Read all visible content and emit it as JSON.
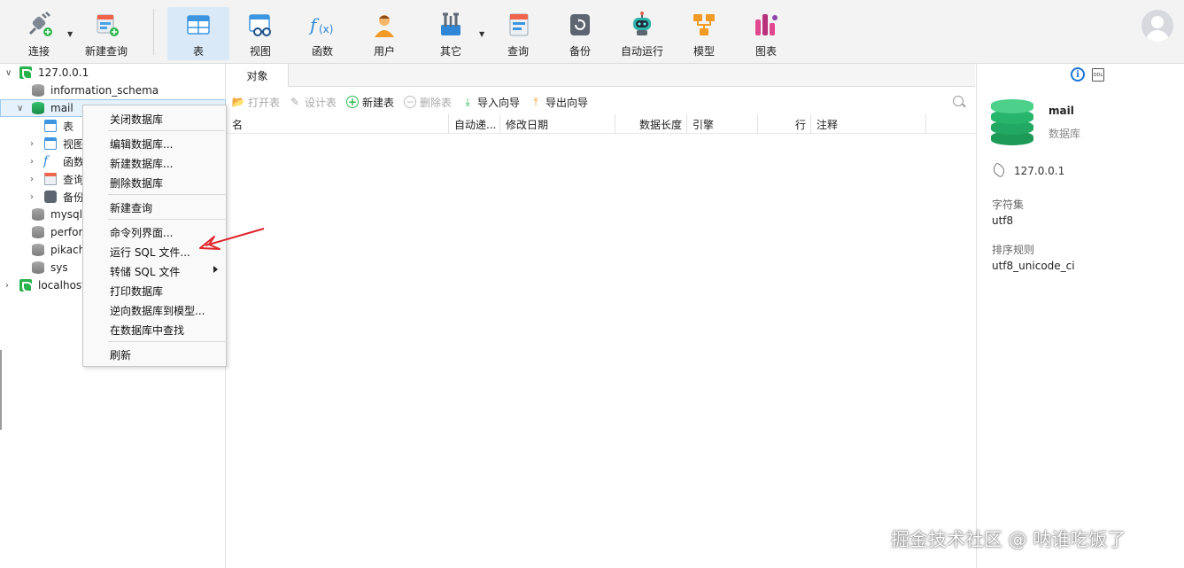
{
  "toolbar": {
    "items": [
      {
        "id": "connect",
        "label": "连接",
        "icon": "plug-icon",
        "has_dropdown": true
      },
      {
        "id": "new-query",
        "label": "新建查询",
        "icon": "new-query-icon",
        "has_dropdown": false
      },
      {
        "id": "table",
        "label": "表",
        "icon": "table-icon",
        "active": true
      },
      {
        "id": "view",
        "label": "视图",
        "icon": "view-icon"
      },
      {
        "id": "function",
        "label": "函数",
        "icon": "function-icon"
      },
      {
        "id": "user",
        "label": "用户",
        "icon": "user-icon"
      },
      {
        "id": "other",
        "label": "其它",
        "icon": "tools-icon",
        "has_dropdown": true
      },
      {
        "id": "query",
        "label": "查询",
        "icon": "query-icon"
      },
      {
        "id": "backup",
        "label": "备份",
        "icon": "backup-icon"
      },
      {
        "id": "automation",
        "label": "自动运行",
        "icon": "robot-icon"
      },
      {
        "id": "model",
        "label": "模型",
        "icon": "model-icon"
      },
      {
        "id": "chart",
        "label": "图表",
        "icon": "chart-icon"
      }
    ]
  },
  "tree": {
    "connection": "127.0.0.1",
    "databases": [
      "information_schema",
      "mail",
      "mysql",
      "perfor",
      "pikach",
      "sys"
    ],
    "mail_children": [
      "表",
      "视图",
      "函数",
      "查询",
      "备份"
    ],
    "other_connection": "localhost"
  },
  "context_menu": {
    "items": [
      "关闭数据库",
      "编辑数据库...",
      "新建数据库...",
      "删除数据库",
      "新建查询",
      "命令列界面...",
      "运行 SQL 文件...",
      "转储 SQL 文件",
      "打印数据库",
      "逆向数据库到模型...",
      "在数据库中查找",
      "刷新"
    ]
  },
  "objects": {
    "tab": "对象",
    "actions": [
      "打开表",
      "设计表",
      "新建表",
      "删除表",
      "导入向导",
      "导出向导"
    ],
    "columns": [
      "名",
      "自动递...",
      "修改日期",
      "数据长度",
      "引擎",
      "行",
      "注释"
    ]
  },
  "info_panel": {
    "name": "mail",
    "type": "数据库",
    "host": "127.0.0.1",
    "charset_label": "字符集",
    "charset": "utf8",
    "collation_label": "排序规则",
    "collation": "utf8_unicode_ci",
    "ddl_label": "DDL"
  },
  "watermark": "掘金技术社区 @ 呐谁吃饭了",
  "colors": {
    "accent": "#1a73d9",
    "selection": "#e5f1fb",
    "db_green": "#1e9a57",
    "arrow_red": "#e0242b"
  }
}
